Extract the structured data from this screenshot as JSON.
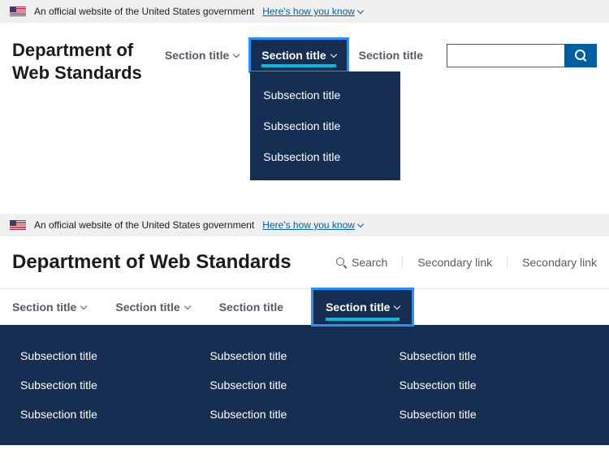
{
  "banner": {
    "text": "An official website of the United States government",
    "link": "Here's how you know"
  },
  "header1": {
    "logo_line1": "Department of",
    "logo_line2": "Web Standards",
    "nav": [
      {
        "label": "Section title"
      },
      {
        "label": "Section title"
      },
      {
        "label": "Section title"
      }
    ],
    "dropdown": [
      "Subsection title",
      "Subsection title",
      "Subsection title"
    ],
    "search_placeholder": ""
  },
  "header2": {
    "logo": "Department of Web Standards",
    "search": "Search",
    "links": [
      "Secondary link",
      "Secondary link"
    ],
    "nav": [
      {
        "label": "Section title"
      },
      {
        "label": "Section title"
      },
      {
        "label": "Section title"
      },
      {
        "label": "Section title"
      }
    ],
    "mega": [
      "Subsection title",
      "Subsection title",
      "Subsection title",
      "Subsection title",
      "Subsection title",
      "Subsection title",
      "Subsection title",
      "Subsection title",
      "Subsection title"
    ]
  }
}
